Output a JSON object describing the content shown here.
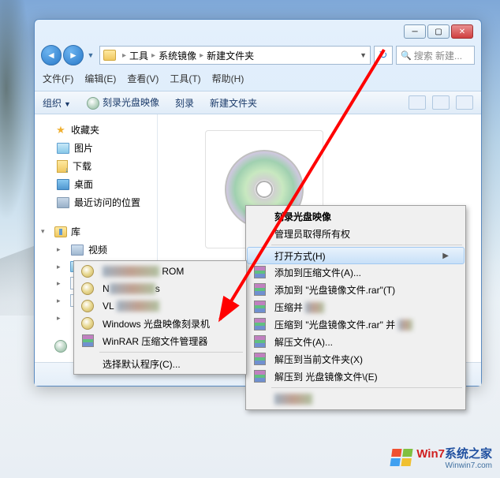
{
  "window": {
    "controls": {
      "min": "─",
      "max": "▢",
      "close": "✕"
    }
  },
  "nav": {
    "back": "◄",
    "fwd": "►",
    "breadcrumb": [
      "工具",
      "系统镜像",
      "新建文件夹"
    ],
    "refresh": "↻",
    "search_placeholder": "搜索 新建..."
  },
  "menubar": [
    {
      "label": "文件(F)"
    },
    {
      "label": "编辑(E)"
    },
    {
      "label": "查看(V)"
    },
    {
      "label": "工具(T)"
    },
    {
      "label": "帮助(H)"
    }
  ],
  "toolbar": {
    "organize": "组织",
    "burn_image": "刻录光盘映像",
    "burn": "刻录",
    "new_folder": "新建文件夹"
  },
  "sidebar": {
    "favorites": {
      "label": "收藏夹",
      "items": [
        {
          "label": "图片",
          "icon": "pic"
        },
        {
          "label": "下载",
          "icon": "dl"
        },
        {
          "label": "桌面",
          "icon": "desk"
        },
        {
          "label": "最近访问的位置",
          "icon": "recent"
        }
      ]
    },
    "libraries": {
      "label": "库",
      "items": [
        {
          "label": "视频",
          "icon": "vid"
        },
        {
          "label": "",
          "icon": "pic-lib"
        },
        {
          "label": "",
          "icon": "doc"
        },
        {
          "label": "",
          "icon": "doc"
        },
        {
          "label": "",
          "icon": "music"
        }
      ]
    },
    "computer": {
      "label": ""
    }
  },
  "context_menu_open_with": {
    "items": [
      {
        "label": "ROM",
        "icon": "cd",
        "blur": true,
        "blurprefix": "xxxxxxxxxxxx"
      },
      {
        "label": "Nero Express",
        "icon": "cd",
        "blur_partial": true
      },
      {
        "label": "VL",
        "icon": "cd",
        "blur": true,
        "blurprefix": "xxxxxxxxx"
      },
      {
        "label": "Windows 光盘映像刻录机",
        "icon": "cd"
      },
      {
        "label": "WinRAR 压缩文件管理器",
        "icon": "rar"
      }
    ],
    "choose_default": "选择默认程序(C)..."
  },
  "context_menu_main": {
    "items_top": [
      {
        "label": "刻录光盘映像",
        "bold": true
      },
      {
        "label": "管理员取得所有权"
      }
    ],
    "open_with": "打开方式(H)",
    "rar_items": [
      {
        "label": "添加到压缩文件(A)..."
      },
      {
        "label": "添加到 \"光盘镜像文件.rar\"(T)"
      },
      {
        "label": "压缩并",
        "blur_suffix": "xxxx"
      },
      {
        "label": "压缩到 \"光盘镜像文件.rar\" 并",
        "blur_suffix": "xxx"
      },
      {
        "label": "解压文件(A)..."
      },
      {
        "label": "解压到当前文件夹(X)"
      },
      {
        "label": "解压到 光盘镜像文件\\(E)"
      }
    ],
    "bottom_blur": "xxxxxxxx"
  },
  "watermark": {
    "brand1": "Win7",
    "brand2": "系统之家",
    "sub": "Winwin7.com"
  }
}
